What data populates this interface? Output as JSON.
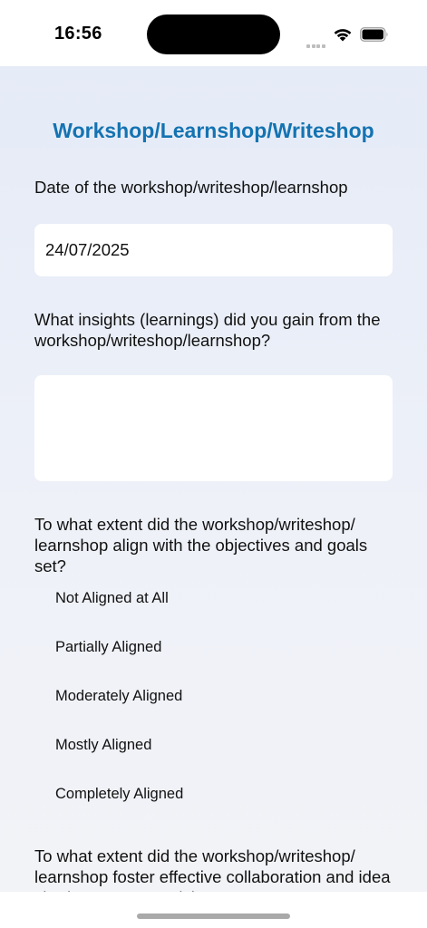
{
  "status_bar": {
    "time": "16:56"
  },
  "form": {
    "title": "Workshop/Learnshop/Writeshop",
    "date_question": "Date of the workshop/writeshop/learnshop",
    "date_value": "24/07/2025",
    "insights_question": "What insights (learnings) did you gain from the workshop/writeshop/learnshop?",
    "insights_value": "",
    "alignment_question": "To what extent did the workshop/writeshop/ learnshop align with the objectives and goals set?",
    "alignment_options": [
      "Not Aligned at All",
      "Partially Aligned",
      "Moderately Aligned",
      "Mostly Aligned",
      "Completely Aligned"
    ],
    "collaboration_question": "To what extent did the workshop/writeshop/ learnshop foster effective collaboration and idea sharing among participants?"
  },
  "icons": {
    "signal": "cellular-signal-icon",
    "wifi": "wifi-icon",
    "battery": "battery-icon"
  },
  "colors": {
    "title": "#1473b2",
    "background_top": "#e5ebf7",
    "background_bottom": "#f2f3f7"
  }
}
